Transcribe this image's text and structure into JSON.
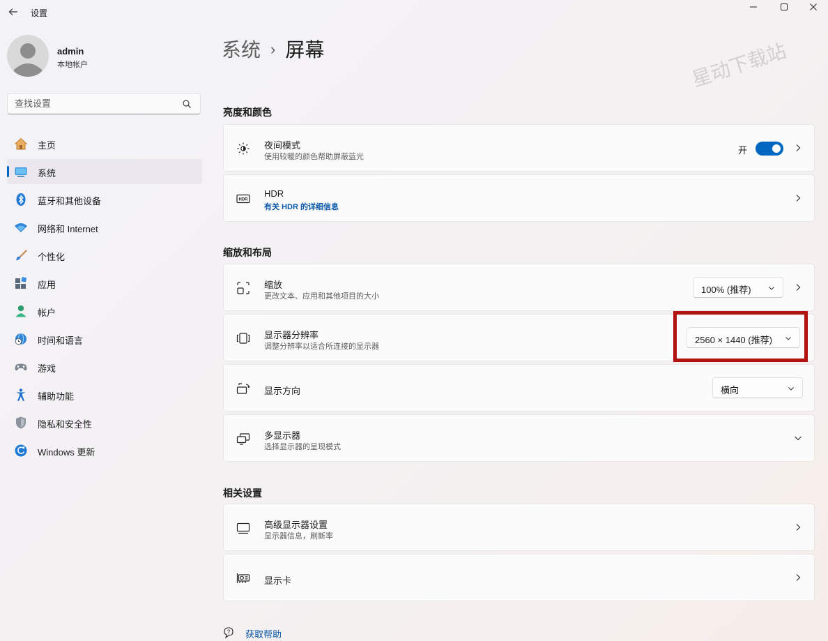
{
  "window": {
    "title": "设置",
    "back_icon": "back-arrow-icon",
    "controls": [
      "minimize-icon",
      "maximize-icon",
      "close-icon"
    ]
  },
  "user": {
    "name": "admin",
    "account_type": "本地帐户"
  },
  "search": {
    "placeholder": "查找设置",
    "icon": "search-icon"
  },
  "sidebar": {
    "items": [
      {
        "label": "主页",
        "icon": "home-icon",
        "active": false
      },
      {
        "label": "系统",
        "icon": "system-display-icon",
        "active": true
      },
      {
        "label": "蓝牙和其他设备",
        "icon": "bluetooth-icon",
        "active": false
      },
      {
        "label": "网络和 Internet",
        "icon": "wifi-icon",
        "active": false
      },
      {
        "label": "个性化",
        "icon": "paintbrush-icon",
        "active": false
      },
      {
        "label": "应用",
        "icon": "apps-icon",
        "active": false
      },
      {
        "label": "帐户",
        "icon": "account-icon",
        "active": false
      },
      {
        "label": "时间和语言",
        "icon": "globe-clock-icon",
        "active": false
      },
      {
        "label": "游戏",
        "icon": "gamepad-icon",
        "active": false
      },
      {
        "label": "辅助功能",
        "icon": "accessibility-icon",
        "active": false
      },
      {
        "label": "隐私和安全性",
        "icon": "shield-icon",
        "active": false
      },
      {
        "label": "Windows 更新",
        "icon": "update-icon",
        "active": false
      }
    ]
  },
  "breadcrumb": {
    "parent": "系统",
    "separator": "›",
    "current": "屏幕"
  },
  "watermark": "星动下载站",
  "sections": {
    "brightness": {
      "title": "亮度和颜色",
      "night_light": {
        "title": "夜间模式",
        "subtitle": "使用较暖的颜色帮助屏蔽蓝光",
        "toggle_label": "开",
        "toggle_on": true
      },
      "hdr": {
        "title": "HDR",
        "subtitle": "有关 HDR 的详细信息"
      }
    },
    "scale_layout": {
      "title": "缩放和布局",
      "scale": {
        "title": "缩放",
        "subtitle": "更改文本、应用和其他项目的大小",
        "value": "100% (推荐)"
      },
      "resolution": {
        "title": "显示器分辨率",
        "subtitle": "调整分辨率以适合所连接的显示器",
        "value": "2560 × 1440 (推荐)"
      },
      "orientation": {
        "title": "显示方向",
        "value": "横向"
      },
      "multi_display": {
        "title": "多显示器",
        "subtitle": "选择显示器的呈现模式"
      }
    },
    "related": {
      "title": "相关设置",
      "advanced": {
        "title": "高级显示器设置",
        "subtitle": "显示器信息，刷新率"
      },
      "graphics": {
        "title": "显示卡"
      }
    }
  },
  "help": {
    "label": "获取帮助"
  },
  "colors": {
    "accent": "#0067c0",
    "link": "#0a57a8",
    "highlight_box": "#b1140f"
  }
}
